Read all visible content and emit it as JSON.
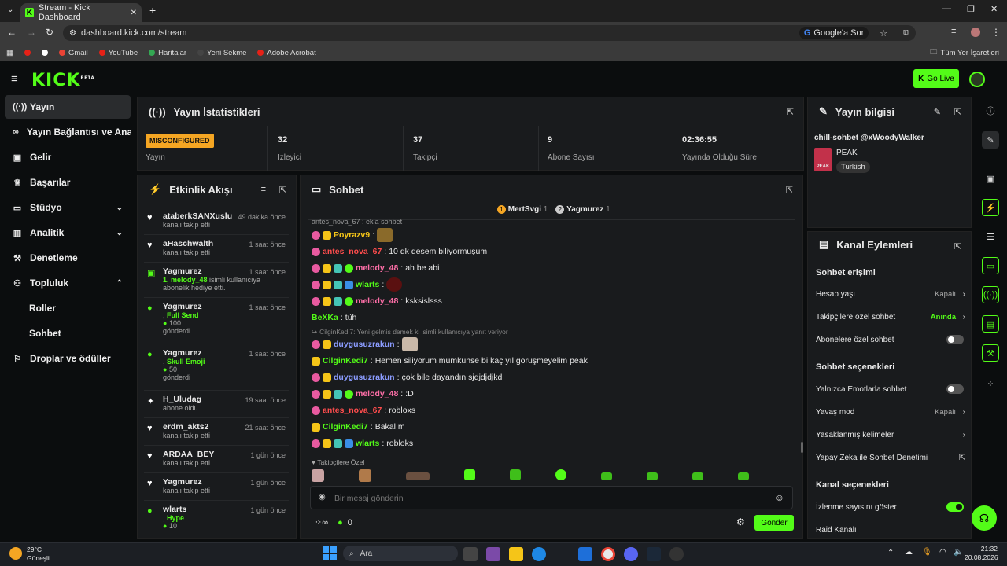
{
  "browser": {
    "tab_title": "Stream - Kick Dashboard",
    "url": "dashboard.kick.com/stream",
    "google_ask": "Google'a Sor",
    "bookmarks": [
      "Gmail",
      "YouTube",
      "Haritalar",
      "Yeni Sekme",
      "Adobe Acrobat"
    ],
    "all_bookmarks": "Tüm Yer İşaretleri"
  },
  "header": {
    "logo": "KICK",
    "logo_sup": "BETA",
    "go_live": "Go Live"
  },
  "sidebar": {
    "items": [
      {
        "label": "Yayın",
        "icon": "broadcast-icon"
      },
      {
        "label": "Yayın Bağlantısı ve Anahtarı",
        "icon": "link-icon"
      },
      {
        "label": "Gelir",
        "icon": "revenue-icon"
      },
      {
        "label": "Başarılar",
        "icon": "trophy-icon"
      },
      {
        "label": "Stüdyo",
        "icon": "studio-icon"
      },
      {
        "label": "Analitik",
        "icon": "analytics-icon"
      },
      {
        "label": "Denetleme",
        "icon": "moderation-icon"
      },
      {
        "label": "Topluluk",
        "icon": "community-icon"
      },
      {
        "label": "Roller"
      },
      {
        "label": "Sohbet"
      },
      {
        "label": "Droplar ve ödüller",
        "icon": "gift-icon"
      }
    ]
  },
  "stats": {
    "title": "Yayın İstatistikleri",
    "misconfigured": "MISCONFIGURED",
    "stream_label": "Yayın",
    "viewers": {
      "value": "32",
      "label": "İzleyici"
    },
    "followers": {
      "value": "37",
      "label": "Takipçi"
    },
    "subs": {
      "value": "9",
      "label": "Abone Sayısı"
    },
    "uptime": {
      "value": "02:36:55",
      "label": "Yayında Olduğu Süre"
    }
  },
  "activity": {
    "title": "Etkinlik Akışı",
    "items": [
      {
        "name": "ataberkSANXuslu",
        "time": "49 dakika önce",
        "sub": "kanalı takip etti"
      },
      {
        "name": "aHaschwalth",
        "time": "1 saat önce",
        "sub": "kanalı takip etti"
      },
      {
        "name": "Yagmurez",
        "time": "1 saat önce",
        "highlight": "1, melody_48",
        "sub": "isimli kullanıcıya abonelik hediye etti."
      },
      {
        "name": "Yagmurez",
        "time": "1 saat önce",
        "highlight": "Full Send",
        "amount": "100",
        "sub": "gönderdi"
      },
      {
        "name": "Yagmurez",
        "time": "1 saat önce",
        "highlight": "Skull Emoji",
        "amount": "50",
        "sub": "gönderdi"
      },
      {
        "name": "H_Uludag",
        "time": "19 saat önce",
        "sub": "abone oldu"
      },
      {
        "name": "erdm_akts2",
        "time": "21 saat önce",
        "sub": "kanalı takip etti"
      },
      {
        "name": "ARDAA_BEY",
        "time": "1 gün önce",
        "sub": "kanalı takip etti"
      },
      {
        "name": "Yagmurez",
        "time": "1 gün önce",
        "sub": "kanalı takip etti"
      },
      {
        "name": "wlarts",
        "time": "1 gün önce",
        "highlight": "Hype",
        "amount": "10"
      }
    ]
  },
  "chat": {
    "title": "Sohbet",
    "top_gifters": [
      {
        "name": "MertSvgi",
        "count": "1"
      },
      {
        "name": "Yagmurez",
        "count": "1"
      }
    ],
    "cut_message": "antes_nova_67 : ekla sohbet",
    "messages": [
      {
        "user": "Poyrazv9",
        "color": "#f5c518",
        "text": "",
        "emote": true
      },
      {
        "user": "antes_nova_67",
        "color": "#ff4d4d",
        "text": "10 dk desem biliyormuşum"
      },
      {
        "user": "melody_48",
        "color": "#ff6fa8",
        "text": "ah be abi"
      },
      {
        "user": "wlarts",
        "color": "#53fc18",
        "text": "",
        "emote": true
      },
      {
        "user": "melody_48",
        "color": "#ff6fa8",
        "text": "ksksislsss"
      },
      {
        "user": "BeXKa",
        "color": "#53fc18",
        "text": "tüh"
      },
      {
        "user": "duygusuzrakun",
        "color": "#8b9cff",
        "text": "",
        "emote": true
      },
      {
        "user": "CilginKedi7",
        "color": "#53fc18",
        "text": "Hemen siliyorum mümkünse bi kaç yıl görüşmeyelim peak"
      },
      {
        "user": "duygusuzrakun",
        "color": "#8b9cff",
        "text": "çok bile dayandın sjdjdjdjkd"
      },
      {
        "user": "melody_48",
        "color": "#ff6fa8",
        "text": ":D"
      },
      {
        "user": "antes_nova_67",
        "color": "#ff4d4d",
        "text": "robloxs"
      },
      {
        "user": "CilginKedi7",
        "color": "#53fc18",
        "text": "Bakalım"
      },
      {
        "user": "wlarts",
        "color": "#53fc18",
        "text": "robloks"
      }
    ],
    "reply_note": "CilginKedi7: Yeni gelmis demek ki isimli kullanıcıya yanıt veriyor",
    "follower_only": "Takipçilere Özel",
    "input_placeholder": "Bir mesaj gönderin",
    "points": "0",
    "send": "Gönder"
  },
  "stream_info": {
    "title": "Yayın bilgisi",
    "stream_title": "chill-sohbet @xWoodyWalker",
    "category": "PEAK",
    "tag": "Turkish"
  },
  "channel_actions": {
    "title": "Kanal Eylemleri",
    "chat_access": "Sohbet erişimi",
    "account_age": {
      "label": "Hesap yaşı",
      "value": "Kapalı"
    },
    "followers_only": {
      "label": "Takipçilere özel sohbet",
      "value": "Anında"
    },
    "subs_only": {
      "label": "Abonelere özel sohbet"
    },
    "chat_options": "Sohbet seçenekleri",
    "emote_only": {
      "label": "Yalnızca Emotlarla sohbet"
    },
    "slow_mode": {
      "label": "Yavaş mod",
      "value": "Kapalı"
    },
    "banned_words": {
      "label": "Yasaklanmış kelimeler"
    },
    "ai_mod": {
      "label": "Yapay Zeka ile Sohbet Denetimi"
    },
    "channel_options": "Kanal seçenekleri",
    "show_viewers": {
      "label": "İzlenme sayısını göster"
    },
    "raid": {
      "label": "Raid Kanalı"
    }
  },
  "taskbar": {
    "weather_temp": "29°C",
    "weather_desc": "Güneşli",
    "search": "Ara",
    "time": "21:32",
    "date": "20.08.2026"
  }
}
